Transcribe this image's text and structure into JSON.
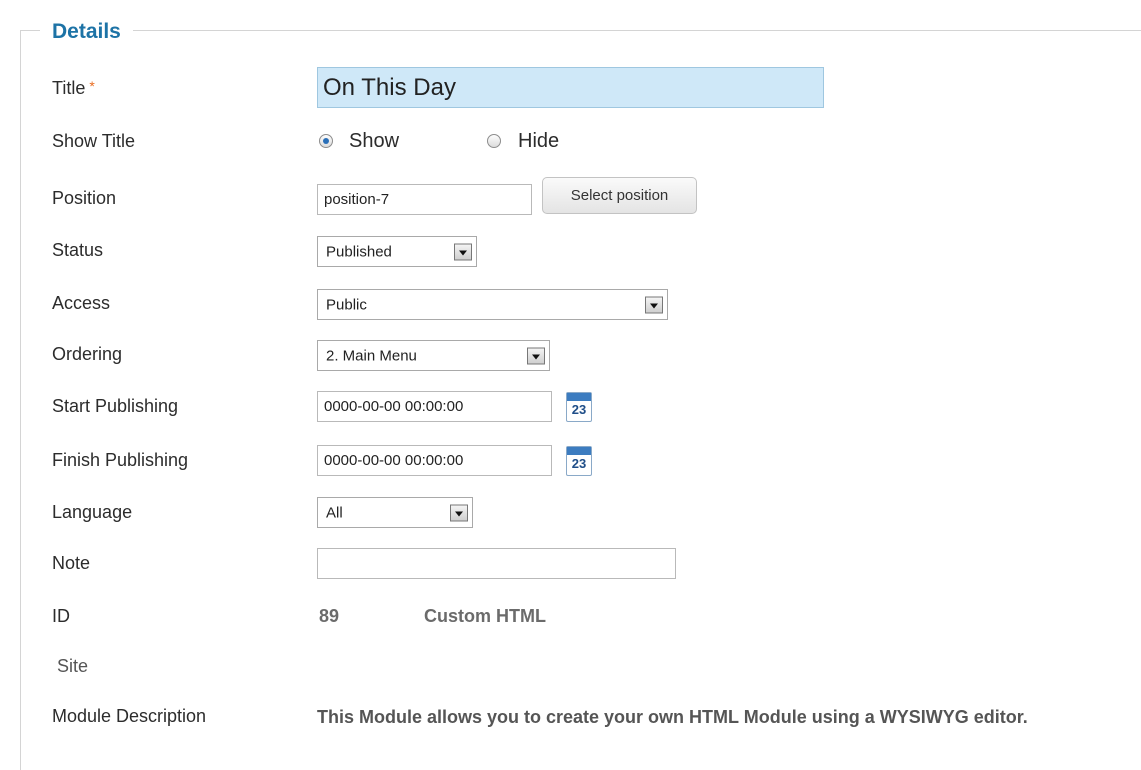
{
  "legend": "Details",
  "fields": {
    "title": {
      "label": "Title",
      "required_mark": "*",
      "value": "On This Day"
    },
    "show_title": {
      "label": "Show Title",
      "option_show": "Show",
      "option_hide": "Hide",
      "selected": "Show"
    },
    "position": {
      "label": "Position",
      "value": "position-7",
      "button": "Select position"
    },
    "status": {
      "label": "Status",
      "value": "Published"
    },
    "access": {
      "label": "Access",
      "value": "Public"
    },
    "ordering": {
      "label": "Ordering",
      "value": "2. Main Menu"
    },
    "start_publishing": {
      "label": "Start Publishing",
      "value": "0000-00-00 00:00:00",
      "calendar_day": "23"
    },
    "finish_publishing": {
      "label": "Finish Publishing",
      "value": "0000-00-00 00:00:00",
      "calendar_day": "23"
    },
    "language": {
      "label": "Language",
      "value": "All"
    },
    "note": {
      "label": "Note",
      "value": ""
    },
    "id": {
      "label": "ID",
      "value": "89",
      "type": "Custom HTML"
    },
    "site": {
      "label": "Site"
    },
    "module_description": {
      "label": "Module Description",
      "value": "This Module allows you to create your own HTML Module using a WYSIWYG editor."
    }
  },
  "icons": {
    "calendar": "calendar-icon",
    "dropdown": "chevron-down-icon"
  },
  "colors": {
    "accent": "#1d73a6",
    "title_bg": "#cfe8f8",
    "required": "#e86b1f"
  }
}
